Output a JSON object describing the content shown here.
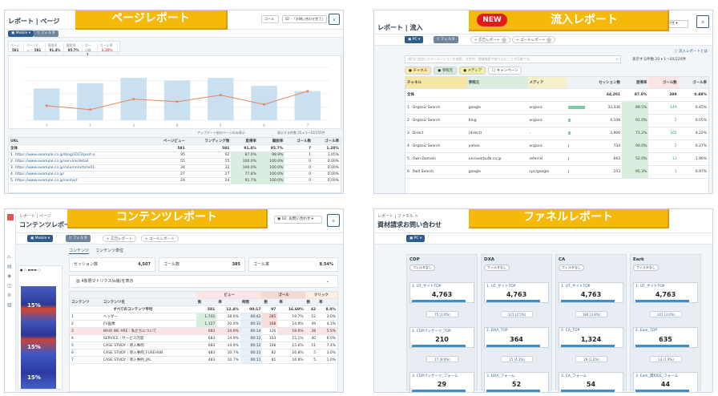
{
  "banners": {
    "page_report": "ページレポート",
    "inflow_report": "流入レポート",
    "inflow_new": "NEW",
    "content_report": "コンテンツレポート",
    "funnel_report": "ファネルレポート"
  },
  "colors": {
    "banner": "#f5b90a",
    "accent": "#2d5d8e",
    "new_badge": "#e41b1b",
    "bar_green": "#7ec7a7",
    "line_orange": "#e8845a",
    "col_bar": "#c9e0f0"
  },
  "page": {
    "breadcrumb": "レポート | ページ",
    "device_pill": "Mobile",
    "filter_pill": "フィルタ",
    "goal_label": "ゴール",
    "goal_value": "02 - 「お問い合わせ完了」",
    "kpis": [
      {
        "label": "ページ",
        "value": "581"
      },
      {
        "label": "ページビュー",
        "value": "581"
      },
      {
        "label": "直帰率",
        "value": "91.4%"
      },
      {
        "label": "離脱率",
        "value": "95.7%"
      },
      {
        "label": "ゴール数",
        "value": "7"
      },
      {
        "label": "ゴール率",
        "value": "1.20%"
      }
    ],
    "chart_data": {
      "type": "bar",
      "categories": [
        "1",
        "2",
        "3",
        "4",
        "5",
        "6",
        "7"
      ],
      "series": [
        {
          "values": [
            120,
            140,
            160,
            150,
            160,
            130,
            110
          ]
        },
        {
          "values": [
            55,
            40,
            80,
            70,
            95,
            60,
            110
          ]
        }
      ]
    },
    "table_caption": "アップデート前のページのみ表示",
    "pager": "表示する件数 25 ▾ 1〜10/155件",
    "columns": [
      "URL",
      "ページビュー",
      "ランディング数",
      "直帰率",
      "離脱率",
      "ゴール数",
      "ゴール率"
    ],
    "total_row": [
      "全体",
      "581",
      "581",
      "91.4%",
      "95.7%",
      "7",
      "1.20%"
    ],
    "rows": [
      [
        "1",
        "https://www.example.co.jp/blog/2023/post-a",
        "95",
        "92",
        "87.0%",
        "98.9%",
        "1",
        "1.05%"
      ],
      [
        "2",
        "https://www.example.co.jp/service/detail",
        "55",
        "55",
        "100.0%",
        "100.0%",
        "0",
        "0.00%"
      ],
      [
        "3",
        "https://www.example.co.jp/column/article01",
        "34",
        "32",
        "100.0%",
        "100.0%",
        "0",
        "0.00%"
      ],
      [
        "4",
        "https://www.example.co.jp/",
        "27",
        "27",
        "77.8%",
        "100.0%",
        "0",
        "0.00%"
      ],
      [
        "5",
        "https://www.example.co.jp/contact",
        "24",
        "24",
        "91.7%",
        "100.0%",
        "0",
        "0.00%"
      ]
    ]
  },
  "inflow": {
    "title": "レポート | 流入",
    "device_pill": "PC",
    "filter_pill": "フィルタ",
    "compare1": "広告レポート",
    "compare2": "ゴールレポート",
    "about_link": "ⓘ 流入レポートとは",
    "search_placeholder": "項目に追加したディメンションを検索。文字列・曖昧検索で絞り込むことが可能です。",
    "pager": "表示する件数 20 ▾  1〜20/220件",
    "dims": [
      "チャネル",
      "参照元",
      "メディア",
      "キャンペーン"
    ],
    "columns": [
      "チャネル",
      "参照元",
      "メディア",
      "セッション数",
      "直帰率",
      "ゴール数",
      "ゴール率"
    ],
    "total_row": [
      "全体",
      "",
      "",
      "44,201",
      "87.0%",
      "389",
      "0.88%"
    ],
    "rows": [
      [
        "1",
        "Organic Search",
        "google",
        "organic",
        "33,336",
        "89.5%",
        "149",
        "0.45%"
      ],
      [
        "2",
        "Organic Search",
        "bing",
        "organic",
        "4,108",
        "91.0%",
        "2",
        "0.05%"
      ],
      [
        "3",
        "Direct",
        "(direct)",
        "-",
        "3,906",
        "71.2%",
        "165",
        "4.22%"
      ],
      [
        "4",
        "Organic Search",
        "yahoo",
        "organic",
        "734",
        "90.0%",
        "2",
        "0.27%"
      ],
      [
        "5",
        "Own Domain",
        "uncoverbutb.co.jp",
        "referral",
        "663",
        "52.0%",
        "13",
        "1.96%"
      ],
      [
        "6",
        "Paid Search",
        "google",
        "cpc/google",
        "103",
        "95.3%",
        "1",
        "0.97%"
      ]
    ]
  },
  "content": {
    "breadcrumb": "レポート | ページ",
    "title": "コンテンツレポート",
    "device_pill": "Mobile",
    "filter_pill": "フィルタ",
    "compare1": "広告レポート",
    "compare2": "ゴールレポート",
    "goal_select": "02: お問い合わせ",
    "tabs": [
      "コンテンツ",
      "コンテンツ単位"
    ],
    "session_label": "セッション数",
    "session_value": "4,507",
    "goal_label": "ゴール数",
    "goal_value": "385",
    "goalrate_label": "ゴール率",
    "goalrate_value": "8.54%",
    "matrix_label": "4象限マトリクス(α版)を表示",
    "heat_percents": [
      "15%",
      "15%",
      "15%"
    ],
    "group_headers": [
      "ビュー",
      "ゴール",
      "クリック"
    ],
    "columns": [
      "コンテンツ",
      "コンテンツ名",
      "数",
      "率",
      "時間",
      "数",
      "率",
      "数",
      "率"
    ],
    "total_row": [
      "すべてのコンテンツ平均",
      "",
      "581",
      "12.4%",
      "00:17",
      "97",
      "16.69%",
      "42",
      "8.0%"
    ],
    "rows": [
      [
        "1",
        "ヘッダー",
        "1,741",
        "28.6%",
        "00:42",
        "285",
        "19.7%",
        "52",
        "3.0%"
      ],
      [
        "2",
        "FV画像",
        "1,127",
        "20.0%",
        "00:31",
        "168",
        "14.9%",
        "49",
        "4.3%"
      ],
      [
        "3",
        "WHO WE ARE｜私たちについて",
        "683",
        "14.9%",
        "00:14",
        "126",
        "18.6%",
        "38",
        "5.5%"
      ],
      [
        "4",
        "SERVICE｜サービス内容",
        "683",
        "14.9%",
        "00:12",
        "103",
        "15.1%",
        "40",
        "6.0%"
      ],
      [
        "5",
        "CASE STUDY｜導入事例",
        "683",
        "14.9%",
        "00:12",
        "106",
        "15.6%",
        "51",
        "7.4%"
      ],
      [
        "6",
        "CASE STUDY｜導入事例_FUSEHUB",
        "483",
        "10.7%",
        "00:11",
        "82",
        "16.8%",
        "5",
        "1.0%"
      ],
      [
        "7",
        "CASE STUDY｜導入事例_JAL",
        "483",
        "10.7%",
        "00:11",
        "81",
        "16.8%",
        "5",
        "1.0%"
      ]
    ]
  },
  "funnel": {
    "breadcrumb": "レポート | ファネル >",
    "title": "資材請求お問い合わせ",
    "device_pill": "PC",
    "columns": [
      {
        "name": "CDP",
        "tag": "フィルタなし",
        "steps": [
          {
            "label": "1. UT_サイトTOP",
            "value": "4,763"
          },
          {
            "label": "2. CDPパッケージ_TOP",
            "value": "210"
          },
          {
            "label": "3. CDPパッケージ_フォーム",
            "value": "29"
          }
        ],
        "drops": [
          "75 (1.6%)",
          "17 (8.9%)"
        ]
      },
      {
        "name": "DXA",
        "tag": "フィルタなし",
        "steps": [
          {
            "label": "1. UT_サイトTOP",
            "value": "4,763"
          },
          {
            "label": "2. DXA_TOP",
            "value": "364"
          },
          {
            "label": "3. DXA_フォーム",
            "value": "52"
          }
        ],
        "drops": [
          "121 (2.5%)",
          "15 (4.1%)"
        ]
      },
      {
        "name": "CA",
        "tag": "フィルタなし",
        "steps": [
          {
            "label": "1. UT_サイトTOP",
            "value": "4,763"
          },
          {
            "label": "2. CA_TOP",
            "value": "1,324"
          },
          {
            "label": "3. CA_フォーム",
            "value": "54"
          }
        ],
        "drops": [
          "184 (3.9%)",
          "29 (2.2%)"
        ]
      },
      {
        "name": "Eark",
        "tag": "フィルタなし",
        "steps": [
          {
            "label": "1. UT_サイトTOP",
            "value": "4,763"
          },
          {
            "label": "2. Eark_TOP",
            "value": "635"
          },
          {
            "label": "3. Eark_資料DL_フォーム",
            "value": "44"
          }
        ],
        "drops": [
          "141 (3.0%)",
          "12 (1.9%)"
        ]
      }
    ]
  }
}
